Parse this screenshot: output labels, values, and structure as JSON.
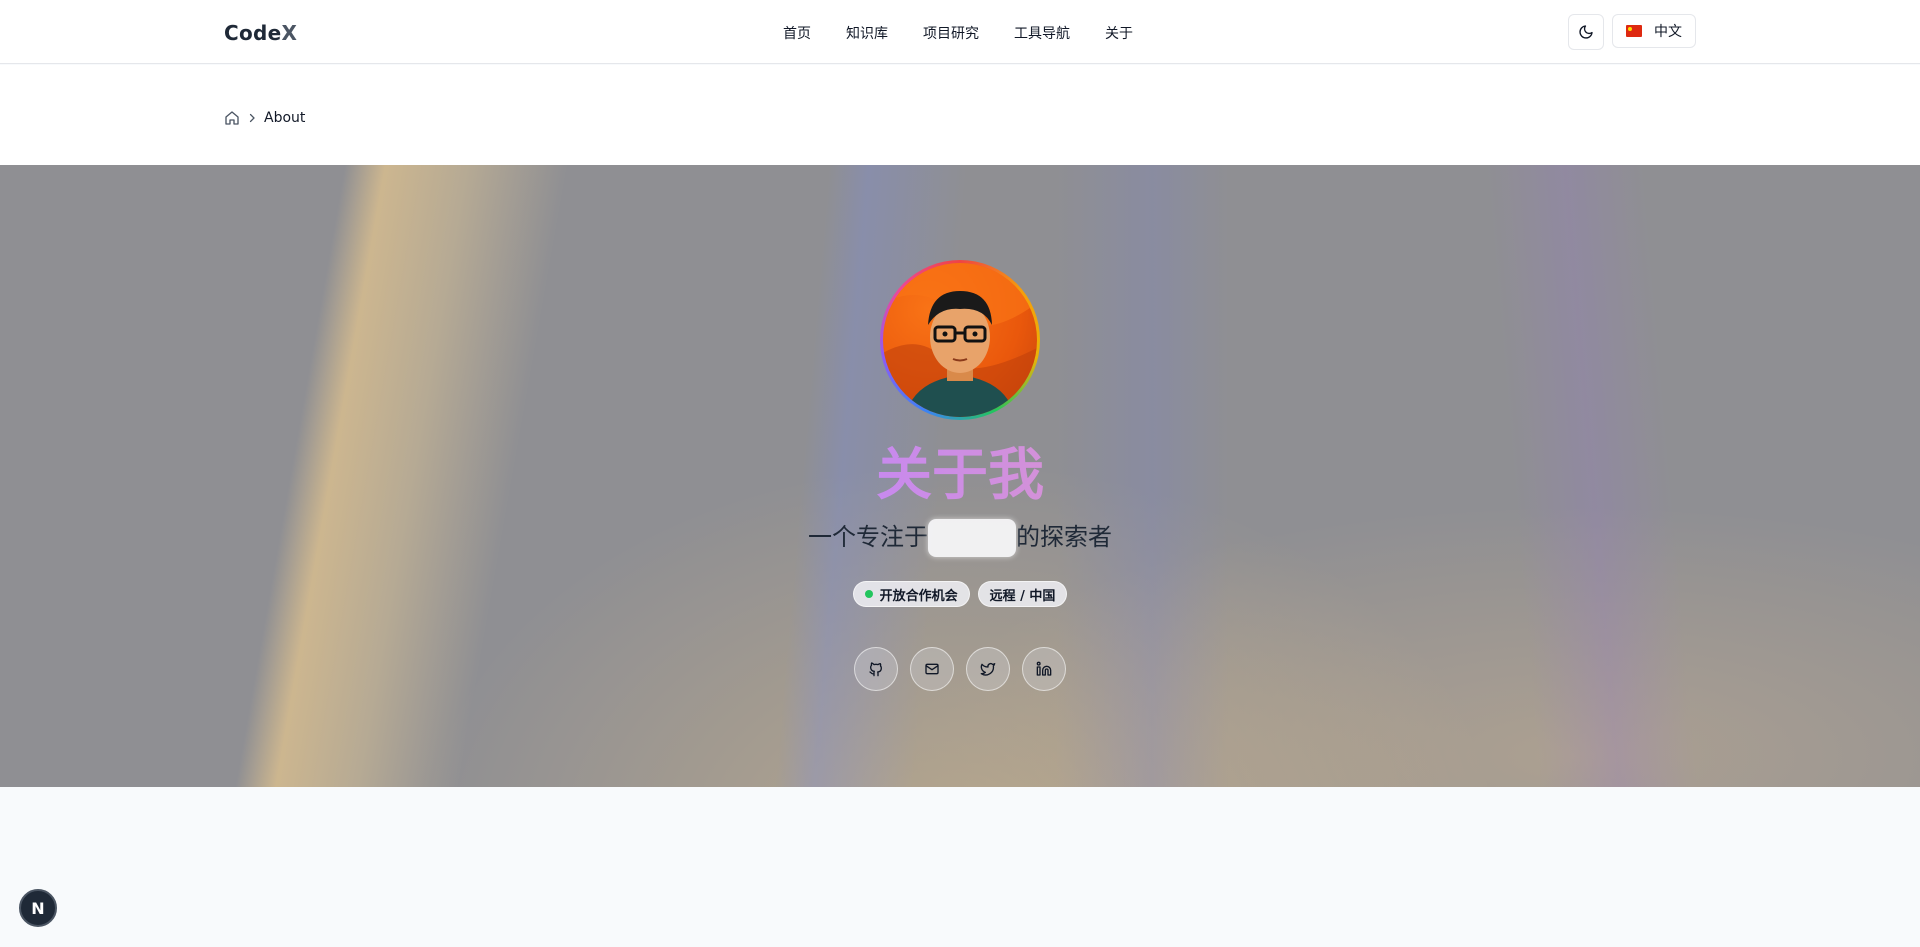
{
  "brand": {
    "name_main": "Code",
    "name_accent": "X"
  },
  "nav": {
    "items": [
      {
        "label": "首页"
      },
      {
        "label": "知识库"
      },
      {
        "label": "项目研究"
      },
      {
        "label": "工具导航"
      },
      {
        "label": "关于"
      }
    ],
    "theme_icon": "moon-icon",
    "language": {
      "label": "中文",
      "flag_icon": "china-flag-icon"
    }
  },
  "breadcrumb": {
    "home_icon": "home-icon",
    "current": "About"
  },
  "hero": {
    "title": "关于我",
    "subtitle_start": "一个专注于",
    "subtitle_end": "的探索者",
    "badges": [
      {
        "label": "开放合作机会",
        "status_color": "#22c55e"
      },
      {
        "label": "远程 / 中国"
      }
    ],
    "socials": [
      {
        "icon": "github-icon"
      },
      {
        "icon": "mail-icon"
      },
      {
        "icon": "twitter-icon"
      },
      {
        "icon": "linkedin-icon"
      }
    ]
  },
  "dev_indicator": {
    "label": "N"
  },
  "colors": {
    "accent_purple": "#a855f7",
    "accent_pink": "#f0a5a5",
    "status_green": "#22c55e"
  }
}
